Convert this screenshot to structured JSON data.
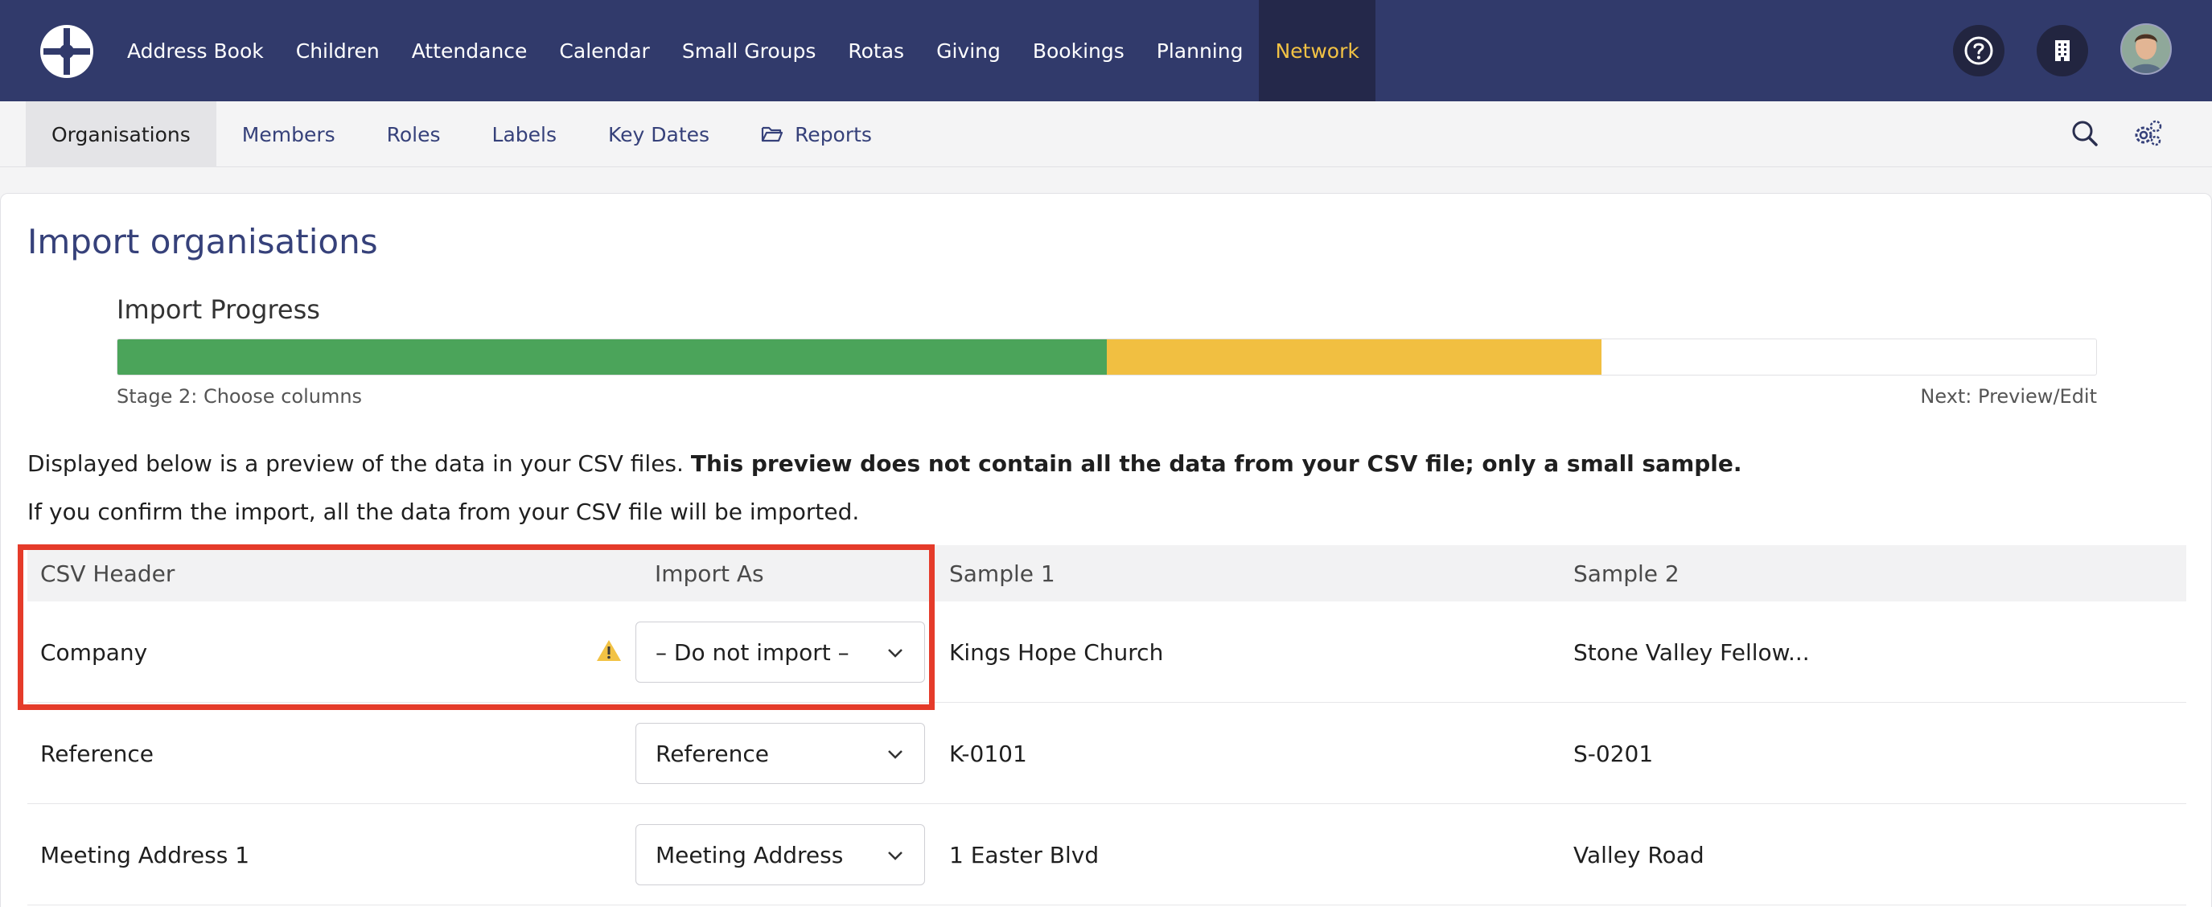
{
  "topnav": {
    "items": [
      "Address Book",
      "Children",
      "Attendance",
      "Calendar",
      "Small Groups",
      "Rotas",
      "Giving",
      "Bookings",
      "Planning",
      "Network"
    ],
    "active_item": "Network",
    "right_icons": [
      "help-icon",
      "building-icon",
      "user-avatar"
    ]
  },
  "subnav": {
    "items": [
      "Organisations",
      "Members",
      "Roles",
      "Labels",
      "Key Dates",
      "Reports"
    ],
    "active_item": "Organisations",
    "right_icons": [
      "search-icon",
      "settings-gears-icon"
    ]
  },
  "page": {
    "title": "Import organisations",
    "progress": {
      "label": "Import Progress",
      "completed_fraction": 0.5,
      "current_stage_fraction": 0.25,
      "stage_text": "Stage 2: Choose columns",
      "next_text": "Next: Preview/Edit"
    },
    "intro_plain": "Displayed below is a preview of the data in your CSV files.",
    "intro_bold": "This preview does not contain all the data from your CSV file; only a small sample.",
    "intro_confirm": "If you confirm the import, all the data from your CSV file will be imported."
  },
  "table": {
    "headers": [
      "CSV Header",
      "Import As",
      "Sample 1",
      "Sample 2"
    ],
    "rows": [
      {
        "csv_header": "Company",
        "import_as": "– Do not import –",
        "warning": true,
        "sample1": "Kings Hope Church",
        "sample2": "Stone Valley Fellow..."
      },
      {
        "csv_header": "Reference",
        "import_as": "Reference",
        "warning": false,
        "sample1": "K-0101",
        "sample2": "S-0201"
      },
      {
        "csv_header": "Meeting Address 1",
        "import_as": "Meeting Address",
        "warning": false,
        "sample1": "1 Easter Blvd",
        "sample2": "Valley Road"
      }
    ]
  },
  "colors": {
    "nav_bg": "#313a6b",
    "nav_active_bg": "#24284a",
    "nav_active_text": "#f2c244",
    "brand_text": "#36417a",
    "progress_done": "#4ba45a",
    "progress_current": "#f1bf41",
    "highlight": "#e53b2a",
    "warning": "#f2c244"
  }
}
